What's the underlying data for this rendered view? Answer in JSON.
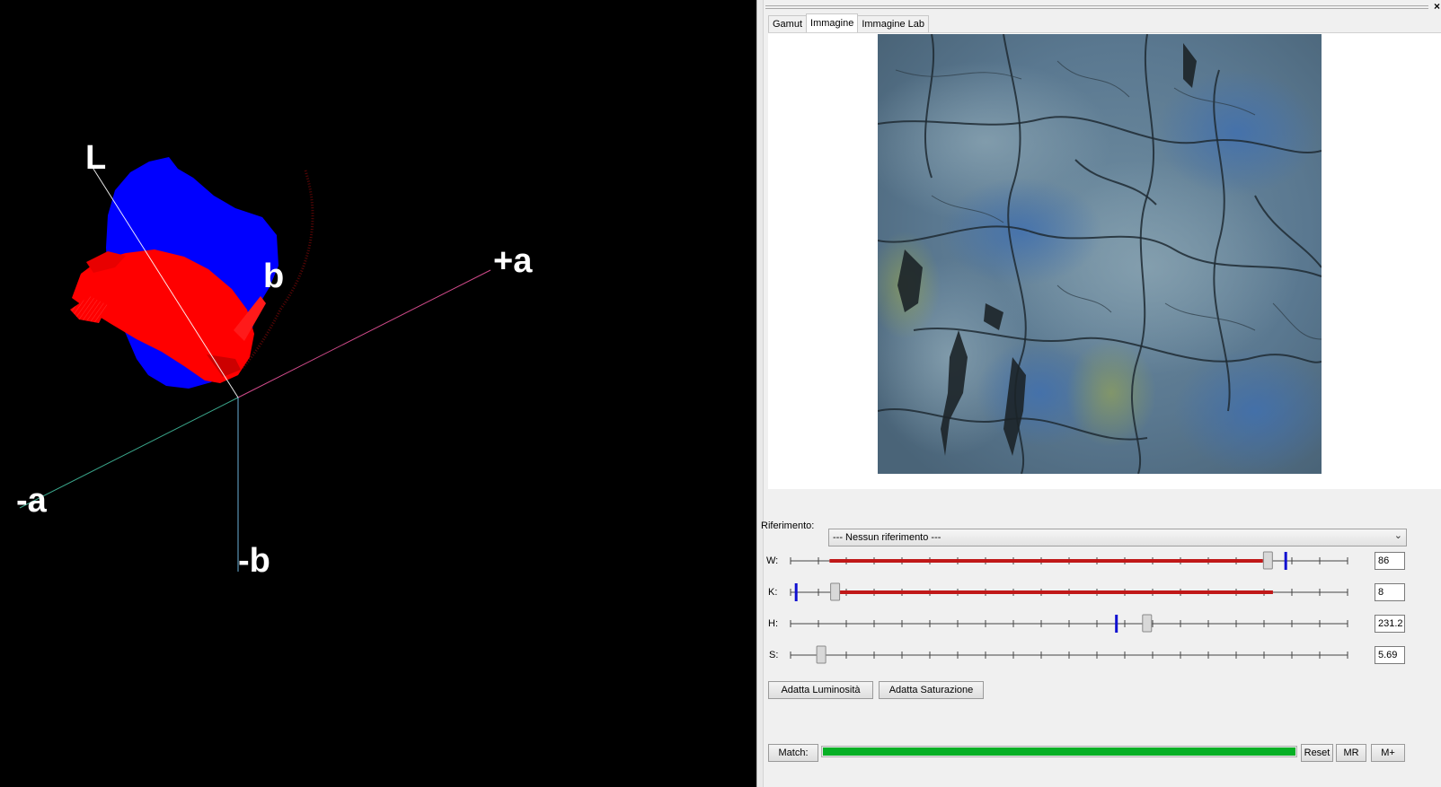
{
  "viewer": {
    "axis_labels": {
      "L": "L",
      "plus_a": "+a",
      "minus_a": "-a",
      "minus_b": "-b",
      "b_partial": "b"
    },
    "colors": {
      "gamut": "#0000ff",
      "image_points": "#ff0000",
      "background": "#000000"
    }
  },
  "panel": {
    "close_label": "×",
    "tabs": [
      "Gamut",
      "Immagine",
      "Immagine Lab"
    ],
    "active_tab": "Immagine",
    "reference": {
      "label": "Riferimento:",
      "value": "--- Nessun riferimento ---"
    },
    "sliders": [
      {
        "key": "W",
        "label": "W:",
        "value": "86",
        "thumb": 0.857,
        "marker": 0.889,
        "range": [
          0.07,
          0.848
        ]
      },
      {
        "key": "K",
        "label": "K:",
        "value": "8",
        "thumb": 0.08,
        "marker": 0.01,
        "range": [
          0.08,
          0.866
        ]
      },
      {
        "key": "H",
        "label": "H:",
        "value": "231.2",
        "thumb": 0.64,
        "marker": 0.585,
        "range": null
      },
      {
        "key": "S",
        "label": "S:",
        "value": "5.69",
        "thumb": 0.055,
        "marker": null,
        "range": null
      }
    ],
    "buttons": {
      "adapt_luminosity": "Adatta Luminosità",
      "adapt_saturation": "Adatta Saturazione"
    },
    "match": {
      "label": "Match:",
      "progress": 1.0,
      "color": "#06b025"
    },
    "bottom_buttons": {
      "reset": "Reset",
      "mr": "MR",
      "mplus": "M+"
    },
    "slider_colors": {
      "range": "#c01818",
      "marker": "#1010d0"
    }
  }
}
